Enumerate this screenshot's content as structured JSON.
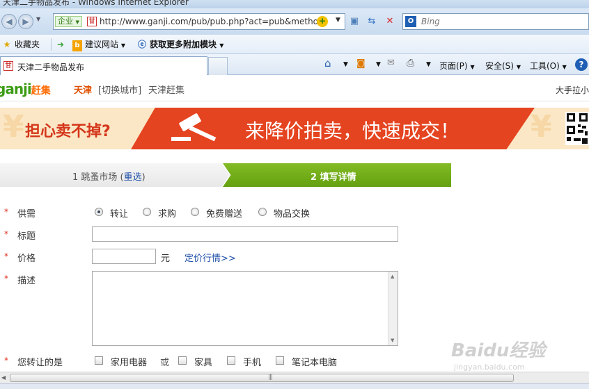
{
  "window": {
    "title": "天津二手物品发布 - Windows Internet Explorer"
  },
  "addressbar": {
    "zone": "企业",
    "url": "http://www.ganji.com/pub/pub.php?act=pub&metho",
    "search_placeholder": "Bing"
  },
  "favorites": {
    "favorites_label": "收藏夹",
    "suggested_label": "建议网站",
    "addons_label": "获取更多附加模块"
  },
  "tabs": [
    {
      "label": "天津二手物品发布"
    }
  ],
  "commandbar": {
    "page_label": "页面(P)",
    "safety_label": "安全(S)",
    "tools_label": "工具(O)"
  },
  "site": {
    "logo_text": "ganji",
    "logo_cn": "赶集",
    "city": "天津",
    "switch_city": "[切换城市]",
    "site_name": "天津赶集",
    "user_greeting": "大手拉小"
  },
  "banner": {
    "left_slogan": "担心卖不掉?",
    "promo": "来降价拍卖，快速成交！"
  },
  "steps": {
    "step1_prefix": "1 跳蚤市场 (",
    "step1_link": "重选",
    "step1_suffix": ")",
    "step2": "2 填写详情"
  },
  "form": {
    "supply": {
      "label": "供需",
      "options": [
        "转让",
        "求购",
        "免费赠送",
        "物品交换"
      ],
      "selected": "转让"
    },
    "title": {
      "label": "标题",
      "value": ""
    },
    "price": {
      "label": "价格",
      "value": "",
      "unit": "元",
      "link": "定价行情>>"
    },
    "description": {
      "label": "描述",
      "value": ""
    },
    "category": {
      "label": "您转让的是",
      "or_text": "或",
      "options": [
        "家用电器",
        "家具",
        "手机",
        "笔记本电脑"
      ]
    }
  },
  "watermark": {
    "main": "Baidu经验",
    "sub": "jingyan.baidu.com"
  },
  "colors": {
    "brand_green": "#64a010",
    "brand_orange": "#ff6a00",
    "link_blue": "#1f4fa8",
    "banner_red": "#e54420"
  }
}
